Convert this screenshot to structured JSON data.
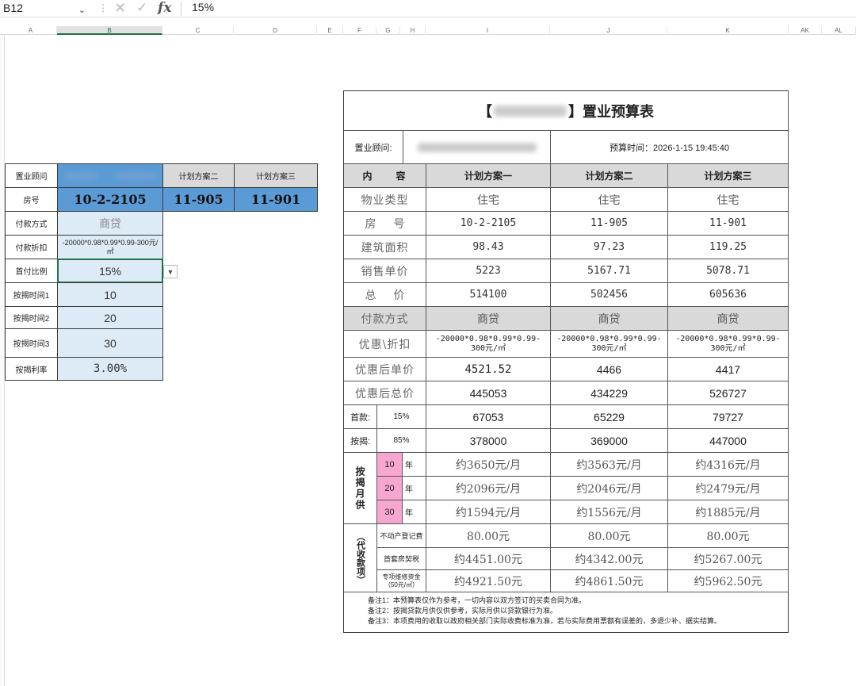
{
  "formula_bar": {
    "name_box": "B12",
    "fx": "fx",
    "value": "15%"
  },
  "columns": [
    "A",
    "B",
    "C",
    "D",
    "E",
    "F",
    "G",
    "H",
    "I",
    "J",
    "K",
    "AK",
    "AL"
  ],
  "left_table": {
    "header": {
      "label": "置业顾问",
      "plan2": "计划方案二",
      "plan3": "计划方案三"
    },
    "room": {
      "label": "房号",
      "plan1": "10-2-2105",
      "plan2": "11-905",
      "plan3": "11-901"
    },
    "rows": [
      {
        "label": "付款方式",
        "value": "商贷"
      },
      {
        "label": "付款折扣",
        "value": "-20000*0.98*0.99*0.99-300元/㎡"
      },
      {
        "label": "首付比例",
        "value": "15%"
      },
      {
        "label": "按揭时间1",
        "value": "10"
      },
      {
        "label": "按揭时间2",
        "value": "20"
      },
      {
        "label": "按揭时间3",
        "value": "30"
      },
      {
        "label": "按揭利率",
        "value": "3.00%"
      }
    ]
  },
  "form": {
    "title_left": "【",
    "title_right": "】置业预算表",
    "advisor_label": "置业顾问:",
    "budget_time": "预算时间：2026-1-15 19:45:40",
    "col_content": "内　　容",
    "plans": [
      "计划方案一",
      "计划方案二",
      "计划方案三"
    ],
    "rows": [
      {
        "label": "物业类型",
        "values": [
          "住宅",
          "住宅",
          "住宅"
        ]
      },
      {
        "label": "房号",
        "values": [
          "10-2-2105",
          "11-905",
          "11-901"
        ]
      },
      {
        "label": "建筑面积",
        "values": [
          "98.43",
          "97.23",
          "119.25"
        ]
      },
      {
        "label": "销售单价",
        "values": [
          "5223",
          "5167.71",
          "5078.71"
        ]
      },
      {
        "label": "总价",
        "values": [
          "514100",
          "502456",
          "605636"
        ]
      }
    ],
    "payment": {
      "label": "付款方式",
      "values": [
        "商贷",
        "商贷",
        "商贷"
      ]
    },
    "discount": {
      "label": "优惠\\折扣",
      "values": [
        "-20000*0.98*0.99*0.99-300元/㎡",
        "-20000*0.98*0.99*0.99-300元/㎡",
        "-20000*0.98*0.99*0.99-300元/㎡"
      ]
    },
    "after_unit": {
      "label": "优惠后单价",
      "values": [
        "4521.52",
        "4466",
        "4417"
      ]
    },
    "after_total": {
      "label": "优惠后总价",
      "values": [
        "445053",
        "434229",
        "526727"
      ]
    },
    "down": {
      "label": "首款:",
      "pct": "15%",
      "values": [
        "67053",
        "65229",
        "79727"
      ]
    },
    "loan": {
      "label": "按揭:",
      "pct": "85%",
      "values": [
        "378000",
        "369000",
        "447000"
      ]
    },
    "monthly": {
      "label": "按揭月供",
      "year_unit": "年",
      "rows": [
        {
          "years": "10",
          "values": [
            "约3650元/月",
            "约3563元/月",
            "约4316元/月"
          ]
        },
        {
          "years": "20",
          "values": [
            "约2096元/月",
            "约2046元/月",
            "约2479元/月"
          ]
        },
        {
          "years": "30",
          "values": [
            "约1594元/月",
            "约1556元/月",
            "约1885元/月"
          ]
        }
      ]
    },
    "fees": {
      "label": "（代收款项）",
      "rows": [
        {
          "label": "不动产登记费",
          "values": [
            "80.00元",
            "80.00元",
            "80.00元"
          ]
        },
        {
          "label": "首套房契税",
          "values": [
            "约4451.00元",
            "约4342.00元",
            "约5267.00元"
          ]
        },
        {
          "label": "专项维修资金（50元/㎡）",
          "values": [
            "约4921.50元",
            "约4861.50元",
            "约5962.50元"
          ]
        }
      ]
    },
    "notes": [
      "备注1：本预算表仅作为参考，一切内容以双方签订的买卖合同为准。",
      "备注2：按揭贷款月供仅供参考，实际月供以贷款银行为准。",
      "备注3：本项费用的收取以政府相关部门实际收费标准为准，若与实际费用票额有误差的，多退少补、据实结算。"
    ]
  }
}
